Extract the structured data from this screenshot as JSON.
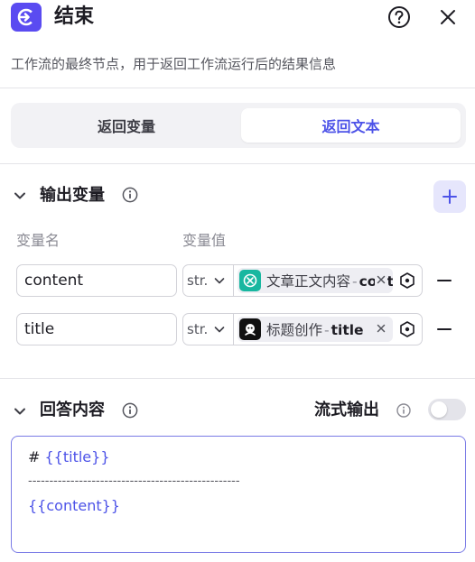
{
  "header": {
    "title": "结束",
    "description": "工作流的最终节点，用于返回工作流运行后的结果信息",
    "icons": {
      "node": "end-node-icon",
      "help": "help-icon",
      "close": "close-icon"
    }
  },
  "mode_tabs": [
    {
      "label": "返回变量",
      "selected": false
    },
    {
      "label": "返回文本",
      "selected": true
    }
  ],
  "output_section": {
    "title": "输出变量",
    "columns": [
      "变量名",
      "变量值"
    ],
    "rows": [
      {
        "name": "content",
        "type": "str.",
        "ref_source": "文章正文内容",
        "ref_separator": "-",
        "ref_var": "content",
        "source_icon": "doc-agent-icon",
        "source_color": "#18b7a0"
      },
      {
        "name": "title",
        "type": "str.",
        "ref_source": "标题创作",
        "ref_separator": "-",
        "ref_var": "title",
        "source_icon": "title-agent-icon",
        "source_color": "#111111"
      }
    ]
  },
  "answer_section": {
    "title": "回答内容",
    "stream_label": "流式输出",
    "stream_enabled": false,
    "editor_lines": [
      "# ",
      "{{title}}",
      "--------------------------------------------------",
      "{{content}}"
    ]
  },
  "colors": {
    "accent": "#4d53e8",
    "node_icon_bg": "#5a4bf1",
    "add_btn_bg": "#e6e6fc"
  }
}
